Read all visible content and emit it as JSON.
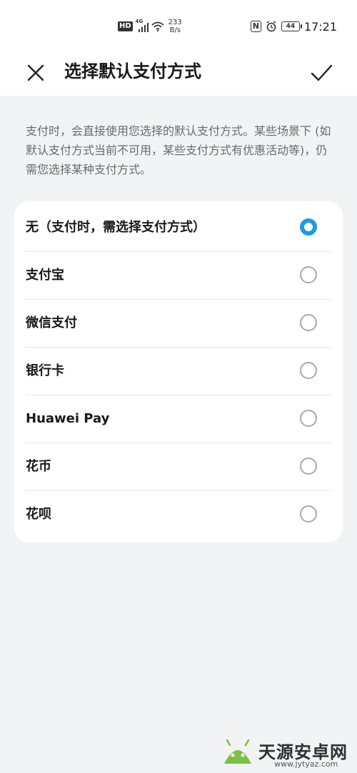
{
  "status_bar": {
    "hd": "HD",
    "network": "4G",
    "speed_value": "233",
    "speed_unit": "B/s",
    "nfc": "N",
    "battery": "44",
    "time": "17:21"
  },
  "header": {
    "title": "选择默认支付方式"
  },
  "description": "支付时，会直接使用您选择的默认支付方式。某些场景下 (如默认支付方式当前不可用，某些支付方式有优惠活动等)，仍需您选择某种支付方式。",
  "options": [
    {
      "label": "无（支付时，需选择支付方式）",
      "selected": true
    },
    {
      "label": "支付宝",
      "selected": false
    },
    {
      "label": "微信支付",
      "selected": false
    },
    {
      "label": "银行卡",
      "selected": false
    },
    {
      "label": "Huawei Pay",
      "selected": false
    },
    {
      "label": "花币",
      "selected": false
    },
    {
      "label": "花呗",
      "selected": false
    }
  ],
  "colors": {
    "accent": "#1c9ae6",
    "background": "#f1f3f5",
    "card": "#ffffff"
  },
  "watermark": {
    "name": "天源安卓网",
    "url": "www.jytyaz.com"
  }
}
